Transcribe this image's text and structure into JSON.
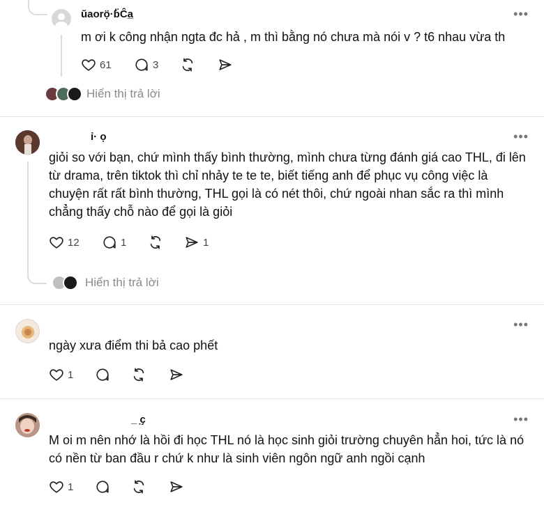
{
  "posts": [
    {
      "username": "ŭaorọ̈·ɓ̈Ĉa̲",
      "text": "m ơi k công nhận ngta đc hả , m thì bằng nó chưa mà nói v ? t6 nhau vừa th",
      "likes": "61",
      "comments": "3",
      "shares": "",
      "replies_label": "Hiển thị trả lời"
    },
    {
      "username": "ỉ· ọ",
      "text": "giỏi so với bạn, chứ mình thấy bình thường, mình chưa từng đánh giá cao THL, đi lên từ drama, trên tiktok thì chỉ nhảy te te te, biết tiếng anh để phục vụ công việc là chuyện rất rất bình thường, THL gọi là có nét thôi, chứ ngoài nhan sắc ra thì mình chẳng thấy chỗ nào để gọi là giỏi",
      "likes": "12",
      "comments": "1",
      "shares": "1",
      "replies_label": "Hiển thị trả lời"
    },
    {
      "username": "",
      "text": "ngày xưa điểm thi bả cao phết",
      "likes": "1",
      "comments": "",
      "shares": ""
    },
    {
      "username": "_ ̣ҫ",
      "text": "M oi m nên nhớ là hồi đi học THL nó là học sinh giỏi trường chuyên hẳn hoi, tức là nó có nền từ ban đầu r chứ k như là sinh viên ngôn ngữ anh ngồi cạnh",
      "likes": "1",
      "comments": "",
      "shares": ""
    }
  ],
  "more_label": "•••",
  "icons": {
    "like": "heart-icon",
    "comment": "comment-bubble-icon",
    "repost": "repost-icon",
    "share": "send-icon",
    "more": "more-dots-icon"
  },
  "colors": {
    "text": "#111111",
    "muted": "#8a8a8a",
    "divider": "#e3e3e3"
  }
}
